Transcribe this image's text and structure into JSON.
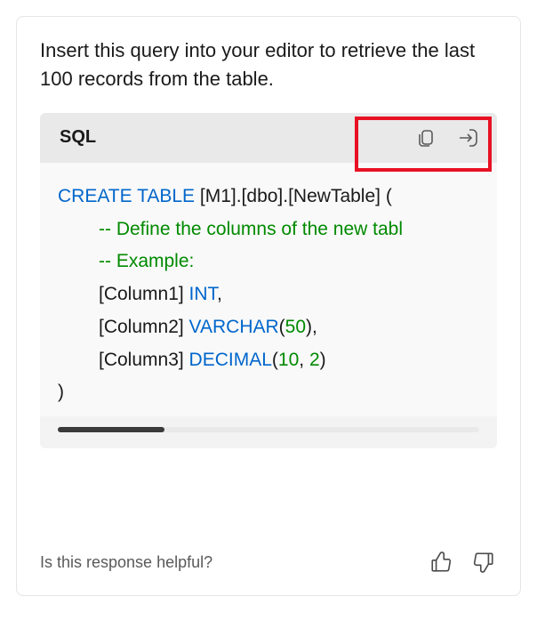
{
  "instruction": "Insert this query into your editor to retrieve the last 100 records from the table.",
  "code": {
    "language": "SQL",
    "lines": {
      "l1_kw": "CREATE TABLE",
      "l1_rest": " [M1].[dbo].[NewTable] (",
      "l2": "-- Define the columns of the new tabl",
      "l3": "-- Example:",
      "l4_a": "[Column1] ",
      "l4_b": "INT",
      "l4_c": ",",
      "l5_a": "[Column2] ",
      "l5_b": "VARCHAR",
      "l5_c": "(",
      "l5_d": "50",
      "l5_e": "),",
      "l6_a": "[Column3] ",
      "l6_b": "DECIMAL",
      "l6_c": "(",
      "l6_d": "10",
      "l6_e": ", ",
      "l6_f": "2",
      "l6_g": ")",
      "l7": ")"
    }
  },
  "feedback": {
    "prompt": "Is this response helpful?"
  }
}
